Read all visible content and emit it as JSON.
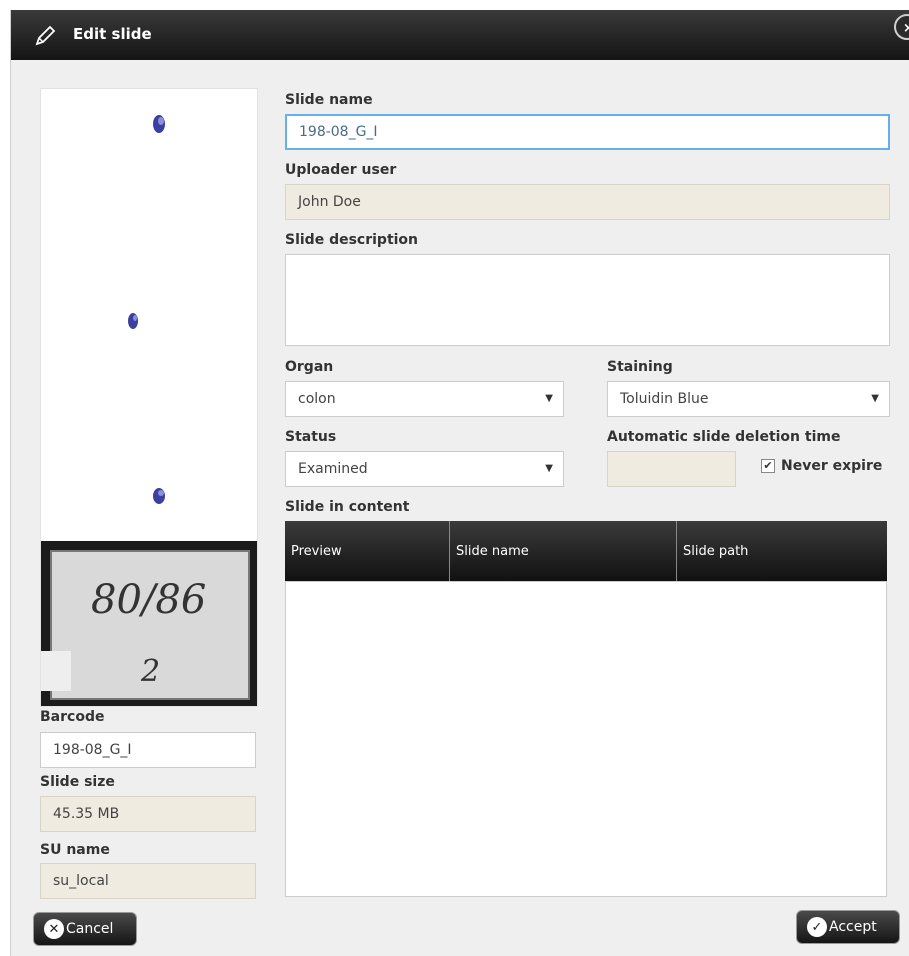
{
  "dialog": {
    "title": "Edit slide",
    "close_glyph": "×"
  },
  "form": {
    "slide_name_label": "Slide name",
    "slide_name_value": "198-08_G_I",
    "uploader_label": "Uploader user",
    "uploader_value": "John Doe",
    "description_label": "Slide description",
    "description_value": "",
    "organ_label": "Organ",
    "organ_value": "colon",
    "staining_label": "Staining",
    "staining_value": "Toluidin Blue",
    "status_label": "Status",
    "status_value": "Examined",
    "deletion_label": "Automatic slide deletion time",
    "deletion_value": "",
    "never_expire_label": "Never expire",
    "never_expire_checked": true,
    "content_label": "Slide in content"
  },
  "grid": {
    "columns": [
      "Preview",
      "Slide name",
      "Slide path"
    ],
    "rows": []
  },
  "left_panel": {
    "barcode_label": "Barcode",
    "barcode_value": "198-08_G_I",
    "size_label": "Slide size",
    "size_value": "45.35 MB",
    "su_label": "SU name",
    "su_value": "su_local",
    "label_handwriting": "80/86",
    "label_mark": "2"
  },
  "footer": {
    "cancel_label": "Cancel",
    "accept_label": "Accept"
  },
  "icons": {
    "title": "pencil-icon",
    "close": "close-icon",
    "cancel": "x-circle-icon",
    "accept": "check-circle-icon",
    "dropdown": "dropdown-arrow-icon"
  },
  "colors": {
    "titlebar": "#1f1f1f",
    "readonly_field": "#efebe0",
    "focus_border": "#66afe9",
    "tissue": "#3b3fa0"
  }
}
